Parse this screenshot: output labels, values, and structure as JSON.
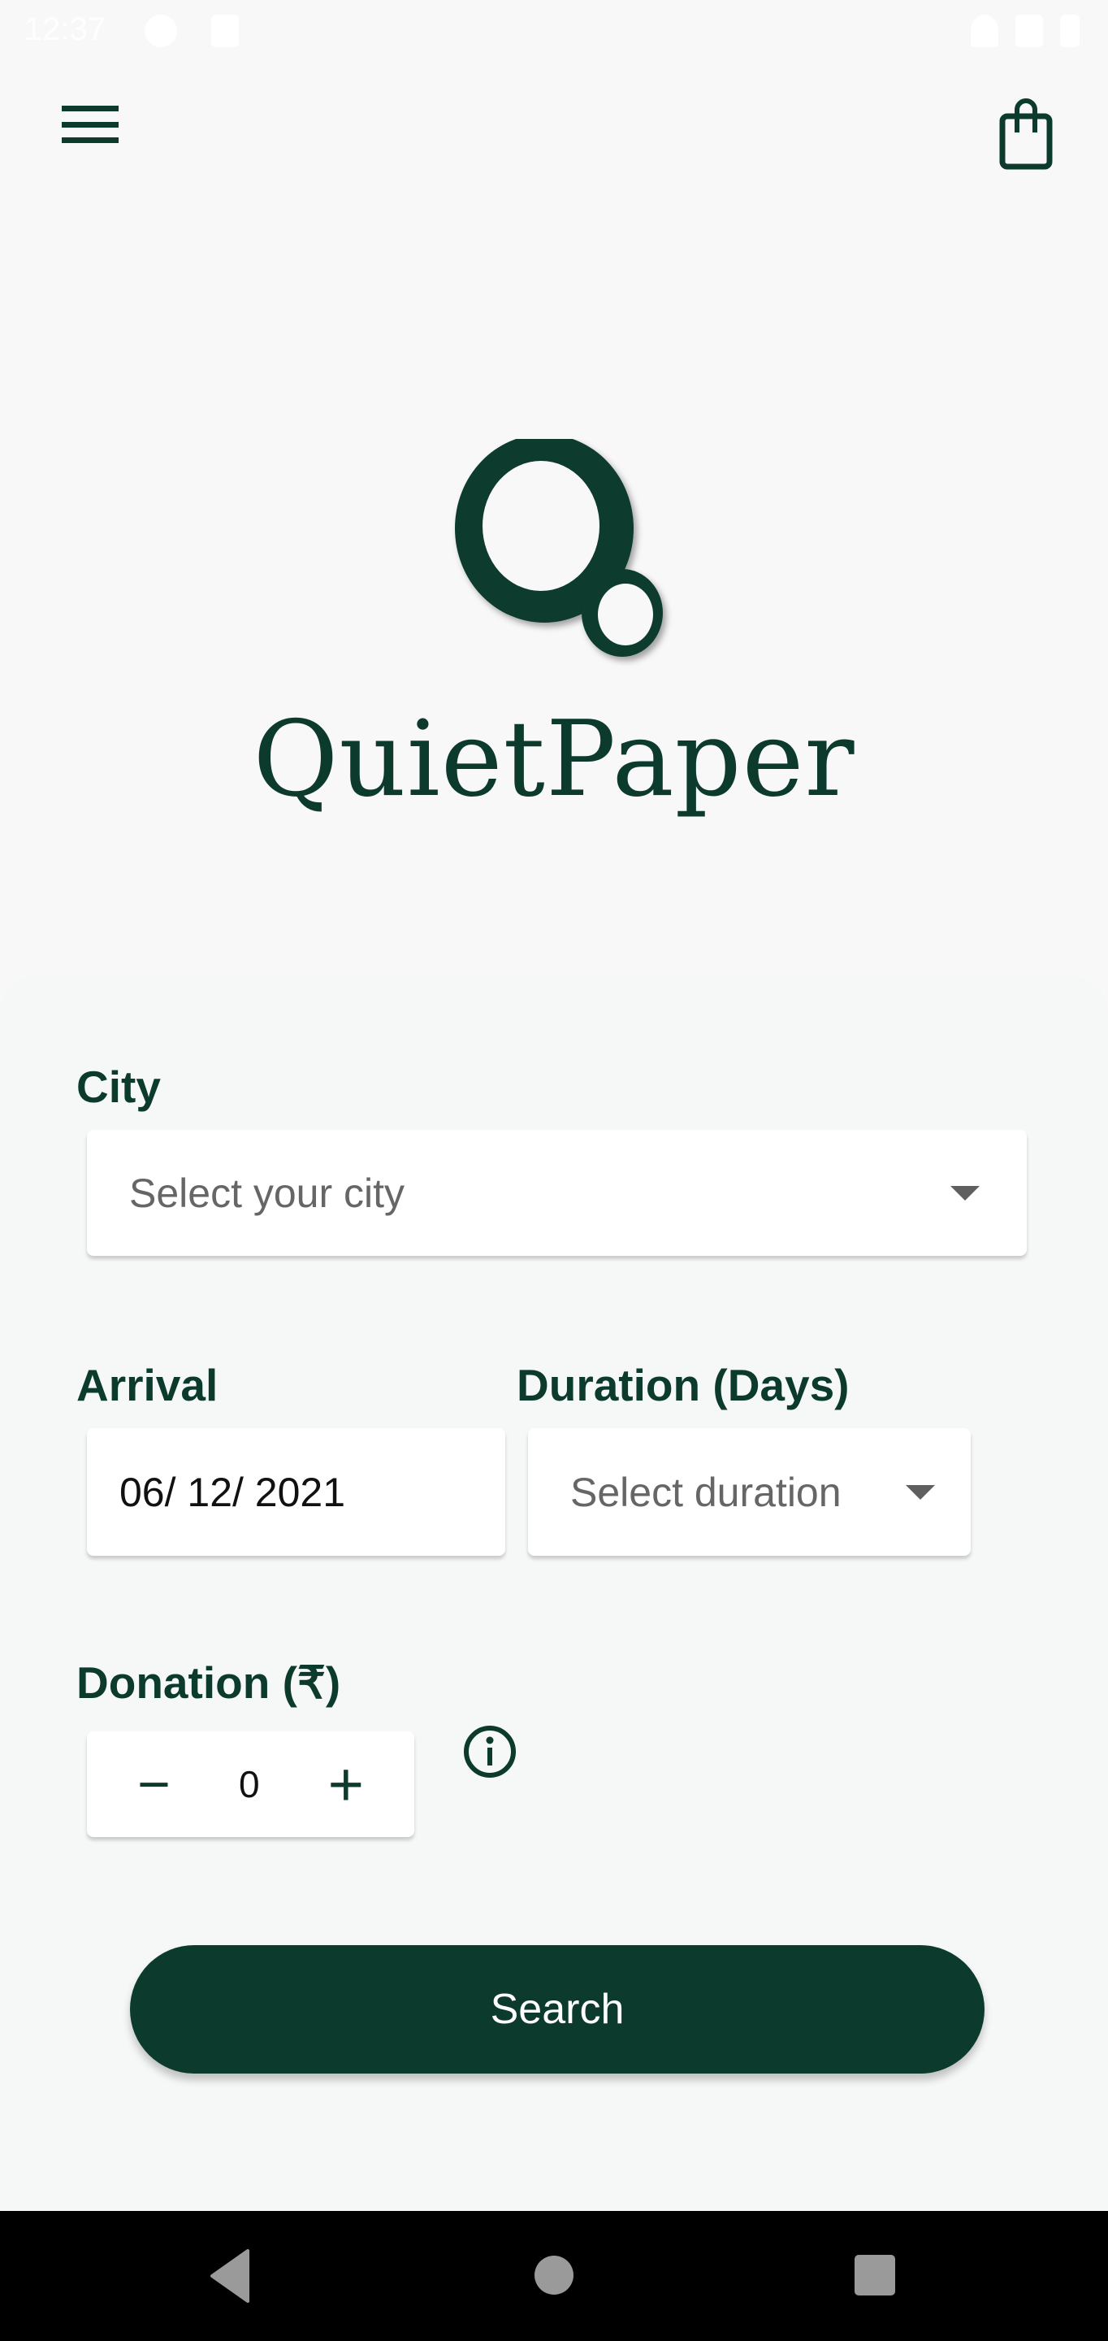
{
  "status_bar": {
    "time": "12:37"
  },
  "app_bar": {
    "menu_icon": "hamburger-menu-icon",
    "cart_icon": "shopping-bag-icon"
  },
  "brand": {
    "name": "QuietPaper",
    "logo_icon": "quietpaper-q-logo"
  },
  "form": {
    "city": {
      "label": "City",
      "placeholder": "Select your city"
    },
    "arrival": {
      "label": "Arrival",
      "value": "06/ 12/ 2021"
    },
    "duration": {
      "label": "Duration (Days)",
      "placeholder": "Select duration"
    },
    "donation": {
      "label": "Donation (₹)",
      "value": "0",
      "minus": "−",
      "plus": "+",
      "info_icon": "info-icon"
    },
    "search_label": "Search"
  },
  "colors": {
    "primary": "#0c3b2e",
    "background": "#f8f8f8",
    "placeholder": "#666666"
  }
}
